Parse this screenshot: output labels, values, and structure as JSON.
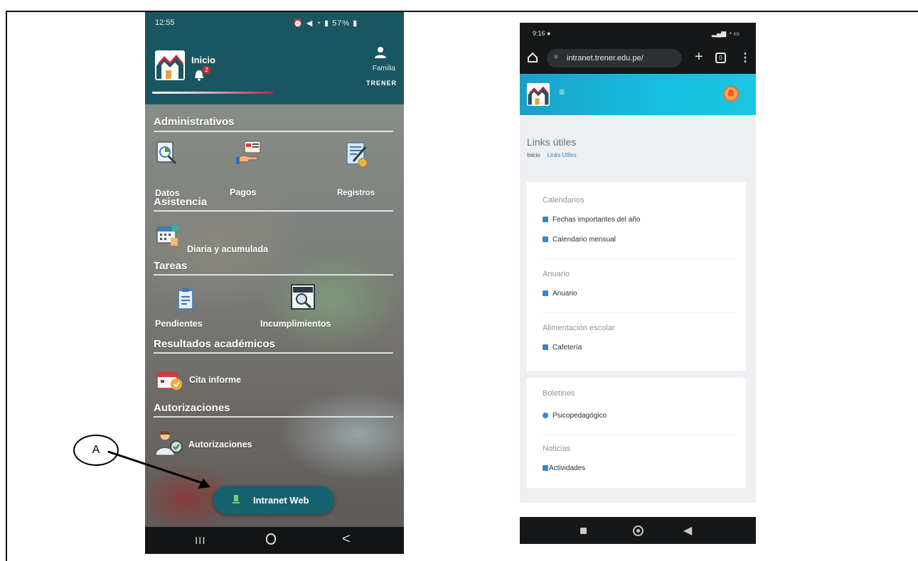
{
  "left_phone": {
    "status": {
      "time": "12:55",
      "signal_text": "57%"
    },
    "header": {
      "title": "Inicio",
      "badge_count": "2",
      "user_label": "Familia",
      "school_name": "TRENER"
    },
    "sections": {
      "administrativos": {
        "title": "Administrativos",
        "items": [
          "Datos",
          "Pagos",
          "Registros"
        ]
      },
      "asistencia": {
        "title": "Asistencia",
        "items": [
          "Diaria y acumulada"
        ]
      },
      "tareas": {
        "title": "Tareas",
        "items": [
          "Pendientes",
          "Incumplimientos"
        ]
      },
      "resultados": {
        "title": "Resultados académicos",
        "items": [
          "Cita informe"
        ]
      },
      "autorizaciones": {
        "title": "Autorizaciones",
        "items": [
          "Autorizaciones"
        ]
      }
    },
    "fab_label": "Intranet Web",
    "nav": {
      "recents": "III",
      "back": "<"
    }
  },
  "callout": {
    "label": "A"
  },
  "right_phone": {
    "status": {
      "time": "9:16"
    },
    "browser": {
      "url": "intranet.trener.edu.pe/",
      "tune_icon": "≡",
      "tabs_count": "0"
    },
    "page": {
      "title": "Links útiles",
      "breadcrumb": [
        "Inicio",
        "Links Utiles"
      ],
      "groups": [
        {
          "name": "Calendarios",
          "links": [
            "Fechas importantes del año",
            "Calendario mensual"
          ]
        },
        {
          "name": "Anuario",
          "links": [
            "Anuario"
          ]
        },
        {
          "name": "Alimentación escolar",
          "links": [
            "Cafetería"
          ]
        },
        {
          "name": "Boletines",
          "links": [
            "Psicopedagógico"
          ]
        },
        {
          "name": "Noticias",
          "links": [
            "Actividades"
          ]
        }
      ]
    }
  },
  "colors": {
    "teal_header": "#1a5661",
    "fab": "#166370",
    "site_header": "#15c0e0",
    "link_icon": "#3a86d0"
  }
}
